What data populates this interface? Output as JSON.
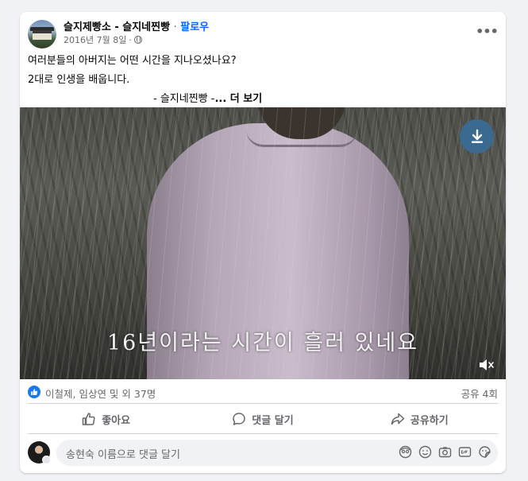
{
  "post": {
    "page_name": "슬지제빵소 - 슬지네찐빵",
    "separator": "·",
    "follow_label": "팔로우",
    "date": "2016년 7월 8일",
    "date_separator": "·",
    "privacy_icon": "globe-icon",
    "more_icon": "more-options-icon",
    "more_label": "•••",
    "text_line1": "여러분들의 아버지는 어떤 시간을 지나오셨나요?",
    "text_line2": "2대로 인생을 배웁니다.",
    "text_line3": "- 슬지네찐빵 -",
    "see_more": "... 더 보기"
  },
  "video": {
    "subtitle": "16년이라는 시간이 흘러 있네요",
    "download_icon": "download-icon",
    "mute_icon": "volume-muted-icon"
  },
  "stats": {
    "reaction_icon": "like-reaction-icon",
    "reactors": "이철제, 임상연 및 외 37명",
    "shares": "공유 4회"
  },
  "actions": [
    {
      "label": "좋아요",
      "icon": "thumbs-up-icon"
    },
    {
      "label": "댓글 달기",
      "icon": "comment-icon"
    },
    {
      "label": "공유하기",
      "icon": "share-icon"
    }
  ],
  "comment": {
    "placeholder": "송현숙 이름으로 댓글 달기",
    "icons": [
      "avatar-sticker-icon",
      "emoji-icon",
      "camera-icon",
      "gif-icon",
      "sticker-icon"
    ]
  },
  "colors": {
    "accent": "#0866ff",
    "like_blue": "#1877f2",
    "secondary_text": "#65676b",
    "background": "#f0f2f5"
  }
}
